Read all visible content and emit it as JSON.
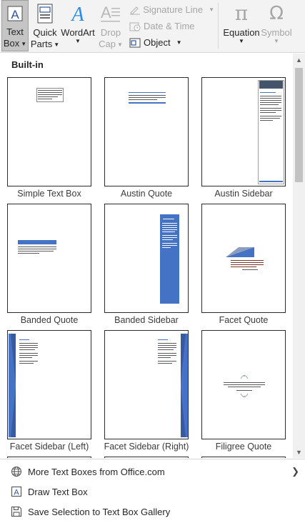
{
  "ribbon": {
    "text_box": {
      "line1": "Text",
      "line2": "Box"
    },
    "quick_parts": {
      "line1": "Quick",
      "line2": "Parts"
    },
    "wordart": {
      "label": "WordArt"
    },
    "drop_cap": {
      "line1": "Drop",
      "line2": "Cap"
    },
    "signature_line": "Signature Line",
    "date_time": "Date & Time",
    "object": "Object",
    "equation": "Equation",
    "symbol": "Symbol",
    "equation_glyph": "π",
    "symbol_glyph": "Ω",
    "wordart_glyph": "A",
    "text_box_glyph": "A"
  },
  "gallery": {
    "section_title": "Built-in",
    "items": [
      {
        "label": "Simple Text Box"
      },
      {
        "label": "Austin Quote"
      },
      {
        "label": "Austin Sidebar"
      },
      {
        "label": "Banded Quote"
      },
      {
        "label": "Banded Sidebar"
      },
      {
        "label": "Facet Quote"
      },
      {
        "label": "Facet Sidebar (Left)"
      },
      {
        "label": "Facet Sidebar (Right)"
      },
      {
        "label": "Filigree Quote"
      }
    ]
  },
  "menu": {
    "more_text_boxes": "More Text Boxes from Office.com",
    "draw_text_box": "Draw Text Box",
    "save_selection": "Save Selection to Text Box Gallery"
  },
  "colors": {
    "accent_blue": "#4472c4",
    "ribbon_bg": "#f3f3f3",
    "disabled_text": "#a6a6a6"
  },
  "icons": [
    "text-box-icon",
    "quick-parts-icon",
    "wordart-icon",
    "drop-cap-icon",
    "signature-line-icon",
    "date-time-icon",
    "object-icon",
    "equation-icon",
    "symbol-icon",
    "globe-icon",
    "draw-text-box-icon",
    "save-icon",
    "chevron-right-icon"
  ]
}
